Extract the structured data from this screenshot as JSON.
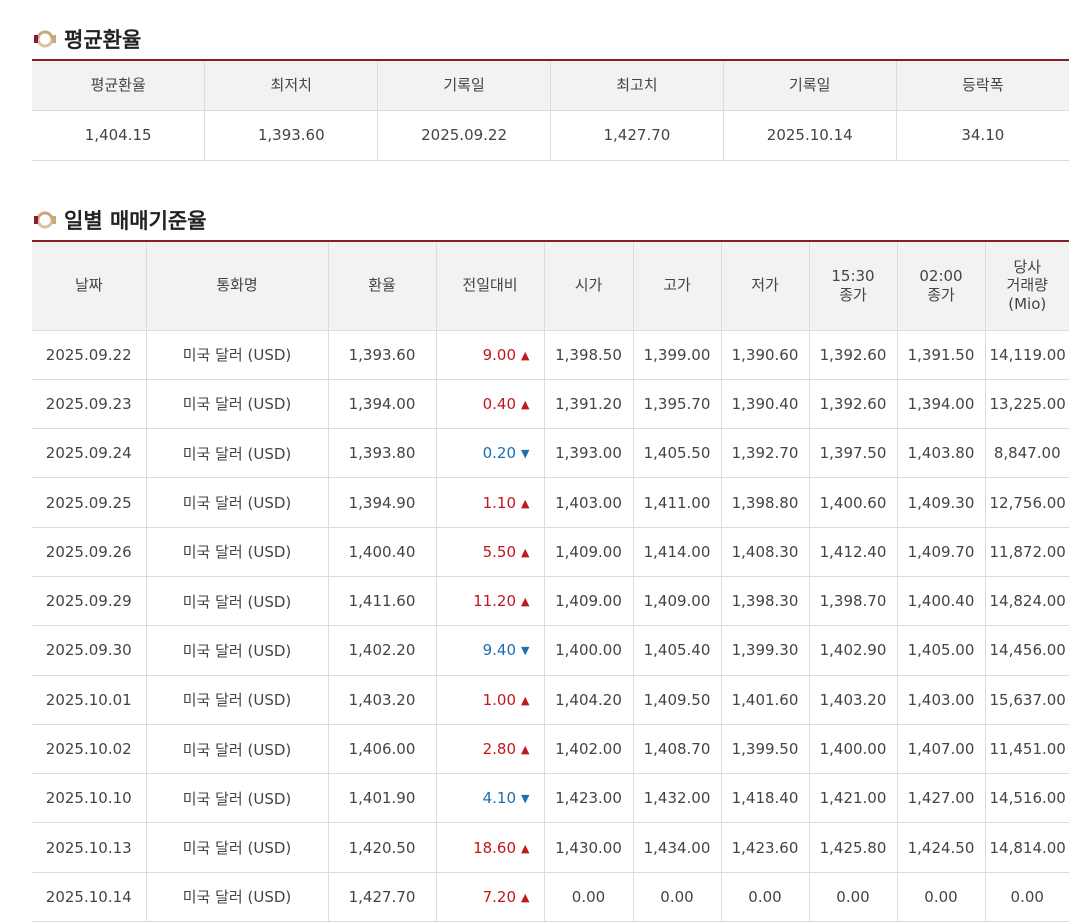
{
  "avg_section": {
    "title": "평균환율",
    "headers": [
      "평균환율",
      "최저치",
      "기록일",
      "최고치",
      "기록일",
      "등락폭"
    ],
    "values": [
      "1,404.15",
      "1,393.60",
      "2025.09.22",
      "1,427.70",
      "2025.10.14",
      "34.10"
    ]
  },
  "daily_section": {
    "title": "일별 매매기준율",
    "headers": [
      "날짜",
      "통화명",
      "환율",
      "전일대비",
      "시가",
      "고가",
      "저가",
      "15:30\n종가",
      "02:00\n종가",
      "당사\n거래량\n(Mio)"
    ],
    "rows": [
      {
        "date": "2025.09.22",
        "currency": "미국 달러 (USD)",
        "rate": "1,393.60",
        "change": "9.00",
        "direction": "up",
        "open": "1,398.50",
        "high": "1,399.00",
        "low": "1,390.60",
        "close1530": "1,392.60",
        "close0200": "1,391.50",
        "volume": "14,119.00"
      },
      {
        "date": "2025.09.23",
        "currency": "미국 달러 (USD)",
        "rate": "1,394.00",
        "change": "0.40",
        "direction": "up",
        "open": "1,391.20",
        "high": "1,395.70",
        "low": "1,390.40",
        "close1530": "1,392.60",
        "close0200": "1,394.00",
        "volume": "13,225.00"
      },
      {
        "date": "2025.09.24",
        "currency": "미국 달러 (USD)",
        "rate": "1,393.80",
        "change": "0.20",
        "direction": "down",
        "open": "1,393.00",
        "high": "1,405.50",
        "low": "1,392.70",
        "close1530": "1,397.50",
        "close0200": "1,403.80",
        "volume": "8,847.00"
      },
      {
        "date": "2025.09.25",
        "currency": "미국 달러 (USD)",
        "rate": "1,394.90",
        "change": "1.10",
        "direction": "up",
        "open": "1,403.00",
        "high": "1,411.00",
        "low": "1,398.80",
        "close1530": "1,400.60",
        "close0200": "1,409.30",
        "volume": "12,756.00"
      },
      {
        "date": "2025.09.26",
        "currency": "미국 달러 (USD)",
        "rate": "1,400.40",
        "change": "5.50",
        "direction": "up",
        "open": "1,409.00",
        "high": "1,414.00",
        "low": "1,408.30",
        "close1530": "1,412.40",
        "close0200": "1,409.70",
        "volume": "11,872.00"
      },
      {
        "date": "2025.09.29",
        "currency": "미국 달러 (USD)",
        "rate": "1,411.60",
        "change": "11.20",
        "direction": "up",
        "open": "1,409.00",
        "high": "1,409.00",
        "low": "1,398.30",
        "close1530": "1,398.70",
        "close0200": "1,400.40",
        "volume": "14,824.00"
      },
      {
        "date": "2025.09.30",
        "currency": "미국 달러 (USD)",
        "rate": "1,402.20",
        "change": "9.40",
        "direction": "down",
        "open": "1,400.00",
        "high": "1,405.40",
        "low": "1,399.30",
        "close1530": "1,402.90",
        "close0200": "1,405.00",
        "volume": "14,456.00"
      },
      {
        "date": "2025.10.01",
        "currency": "미국 달러 (USD)",
        "rate": "1,403.20",
        "change": "1.00",
        "direction": "up",
        "open": "1,404.20",
        "high": "1,409.50",
        "low": "1,401.60",
        "close1530": "1,403.20",
        "close0200": "1,403.00",
        "volume": "15,637.00"
      },
      {
        "date": "2025.10.02",
        "currency": "미국 달러 (USD)",
        "rate": "1,406.00",
        "change": "2.80",
        "direction": "up",
        "open": "1,402.00",
        "high": "1,408.70",
        "low": "1,399.50",
        "close1530": "1,400.00",
        "close0200": "1,407.00",
        "volume": "11,451.00"
      },
      {
        "date": "2025.10.10",
        "currency": "미국 달러 (USD)",
        "rate": "1,401.90",
        "change": "4.10",
        "direction": "down",
        "open": "1,423.00",
        "high": "1,432.00",
        "low": "1,418.40",
        "close1530": "1,421.00",
        "close0200": "1,427.00",
        "volume": "14,516.00"
      },
      {
        "date": "2025.10.13",
        "currency": "미국 달러 (USD)",
        "rate": "1,420.50",
        "change": "18.60",
        "direction": "up",
        "open": "1,430.00",
        "high": "1,434.00",
        "low": "1,423.60",
        "close1530": "1,425.80",
        "close0200": "1,424.50",
        "volume": "14,814.00"
      },
      {
        "date": "2025.10.14",
        "currency": "미국 달러 (USD)",
        "rate": "1,427.70",
        "change": "7.20",
        "direction": "up",
        "open": "0.00",
        "high": "0.00",
        "low": "0.00",
        "close1530": "0.00",
        "close0200": "0.00",
        "volume": "0.00"
      }
    ]
  },
  "colors": {
    "accent_border": "#8b1a2b",
    "up": "#c4161c",
    "down": "#1a6fb5",
    "icon": "ring-icon"
  }
}
